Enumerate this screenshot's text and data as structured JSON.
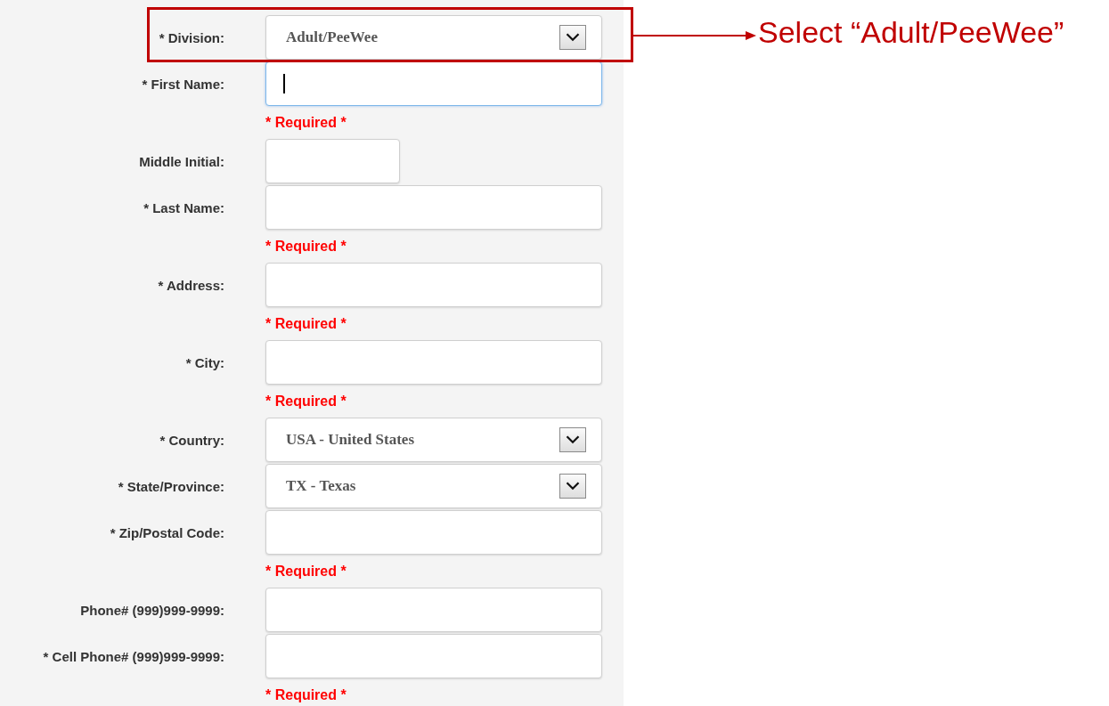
{
  "form": {
    "fields": [
      {
        "label": "* Division:",
        "kind": "select",
        "value": "Adult/PeeWee",
        "focused": false
      },
      {
        "label": "* First Name:",
        "kind": "text",
        "focused": true,
        "error": "* Required *"
      },
      {
        "label": "Middle Initial:",
        "kind": "short-text",
        "focused": false
      },
      {
        "label": "* Last Name:",
        "kind": "text",
        "focused": false,
        "error": "* Required *"
      },
      {
        "label": "* Address:",
        "kind": "text",
        "focused": false,
        "error": "* Required *"
      },
      {
        "label": "* City:",
        "kind": "text",
        "focused": false,
        "error": "* Required *"
      },
      {
        "label": "* Country:",
        "kind": "select",
        "value": "USA - United States",
        "focused": false
      },
      {
        "label": "* State/Province:",
        "kind": "select",
        "value": "TX - Texas",
        "focused": false
      },
      {
        "label": "* Zip/Postal Code:",
        "kind": "text",
        "focused": false,
        "error": "* Required *"
      },
      {
        "label": "Phone# (999)999-9999:",
        "kind": "text",
        "focused": false
      },
      {
        "label": "* Cell Phone# (999)999-9999:",
        "kind": "text",
        "focused": false,
        "error": "* Required *"
      }
    ]
  },
  "callout": {
    "text": "Select “Adult/PeeWee”"
  }
}
